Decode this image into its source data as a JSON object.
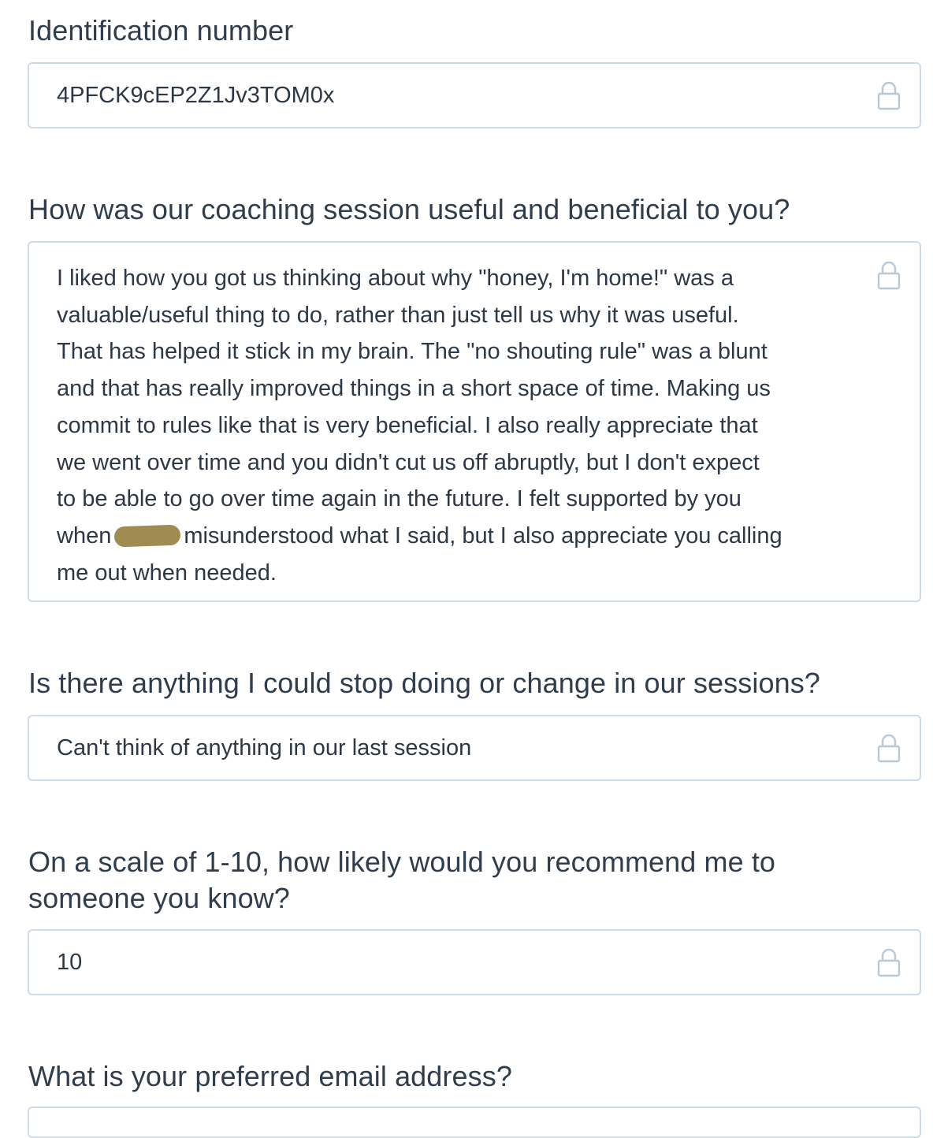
{
  "form": {
    "identification": {
      "label": "Identification number",
      "value": "4PFCK9cEP2Z1Jv3TOM0x"
    },
    "useful": {
      "label": "How was our coaching session useful and beneficial to you?",
      "lines": [
        "I liked how you got us thinking about why \"honey, I'm home!\" was a",
        "valuable/useful thing to do, rather than just tell us why it was useful.",
        "That has helped it stick in my brain. The \"no shouting rule\" was a blunt",
        "and that has really improved things in a short space of time. Making us",
        "commit to rules like that is very beneficial. I also really appreciate that",
        "we went over time and you didn't cut us off abruptly, but I don't expect",
        "to be able to go over time again in the future. I felt supported by you"
      ],
      "line_before_redaction": "when",
      "line_after_redaction": "misunderstood what I said, but I also appreciate you calling",
      "last_line": "me out when needed."
    },
    "change": {
      "label": "Is there anything I could stop doing or change in our sessions?",
      "value": "Can't think of anything in our last session"
    },
    "recommend": {
      "label_line1": "On a scale of 1-10, how likely would you recommend me to",
      "label_line2": "someone you know?",
      "value": "10"
    },
    "email": {
      "label": "What is your preferred email address?"
    }
  },
  "colors": {
    "border": "#cfdbe6",
    "lock_icon": "#b9c8d6",
    "label_text": "#2f3d4c",
    "value_text": "#2c3846",
    "redaction": "#a08b52"
  },
  "icons": {
    "field_lock": "lock-icon"
  }
}
